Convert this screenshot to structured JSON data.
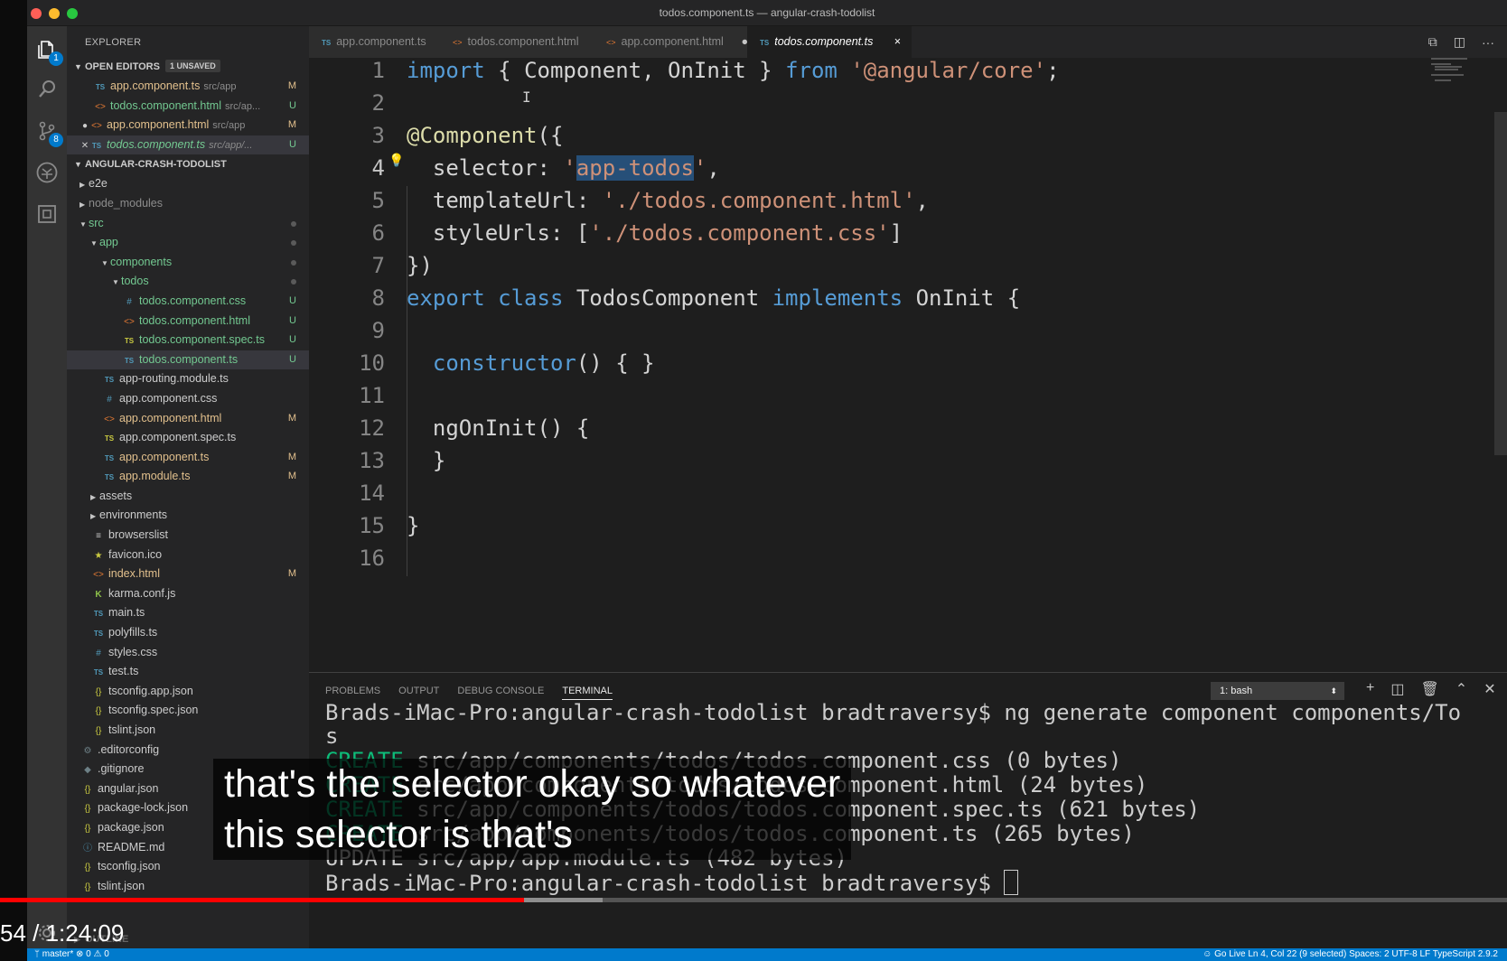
{
  "window": {
    "title": "todos.component.ts — angular-crash-todolist"
  },
  "activity_bar": {
    "explorer_badge": "1",
    "scm_badge": "8"
  },
  "sidebar": {
    "header": "EXPLORER",
    "open_editors": {
      "label": "OPEN EDITORS",
      "unsaved": "1 UNSAVED",
      "items": [
        {
          "name": "app.component.ts",
          "path": "src/app",
          "status": "M",
          "icon": "ts"
        },
        {
          "name": "todos.component.html",
          "path": "src/ap...",
          "status": "U",
          "icon": "html"
        },
        {
          "name": "app.component.html",
          "path": "src/app",
          "status": "M",
          "icon": "html"
        },
        {
          "name": "todos.component.ts",
          "path": "src/app/...",
          "status": "U",
          "icon": "ts"
        }
      ]
    },
    "project": {
      "label": "ANGULAR-CRASH-TODOLIST",
      "tree": [
        {
          "name": "e2e"
        },
        {
          "name": "node_modules"
        },
        {
          "name": "src"
        },
        {
          "name": "app"
        },
        {
          "name": "components"
        },
        {
          "name": "todos"
        },
        {
          "name": "todos.component.css",
          "status": "U"
        },
        {
          "name": "todos.component.html",
          "status": "U"
        },
        {
          "name": "todos.component.spec.ts",
          "status": "U"
        },
        {
          "name": "todos.component.ts",
          "status": "U"
        },
        {
          "name": "app-routing.module.ts"
        },
        {
          "name": "app.component.css"
        },
        {
          "name": "app.component.html",
          "status": "M"
        },
        {
          "name": "app.component.spec.ts"
        },
        {
          "name": "app.component.ts",
          "status": "M"
        },
        {
          "name": "app.module.ts",
          "status": "M"
        },
        {
          "name": "assets"
        },
        {
          "name": "environments"
        },
        {
          "name": "browserslist"
        },
        {
          "name": "favicon.ico"
        },
        {
          "name": "index.html",
          "status": "M"
        },
        {
          "name": "karma.conf.js"
        },
        {
          "name": "main.ts"
        },
        {
          "name": "polyfills.ts"
        },
        {
          "name": "styles.css"
        },
        {
          "name": "test.ts"
        },
        {
          "name": "tsconfig.app.json"
        },
        {
          "name": "tsconfig.spec.json"
        },
        {
          "name": "tslint.json"
        },
        {
          "name": ".editorconfig"
        },
        {
          "name": ".gitignore"
        },
        {
          "name": "angular.json"
        },
        {
          "name": "package-lock.json"
        },
        {
          "name": "package.json"
        },
        {
          "name": "README.md"
        },
        {
          "name": "tsconfig.json"
        },
        {
          "name": "tslint.json"
        }
      ]
    },
    "outline_label": "OUTLINE"
  },
  "tabs": [
    {
      "label": "app.component.ts",
      "icon": "TS",
      "marker": ""
    },
    {
      "label": "todos.component.html",
      "icon": "<>",
      "marker": ""
    },
    {
      "label": "app.component.html",
      "icon": "<>",
      "marker": "●"
    },
    {
      "label": "todos.component.ts",
      "icon": "TS",
      "marker": "×"
    }
  ],
  "editor": {
    "line_numbers": [
      "1",
      "2",
      "3",
      "4",
      "5",
      "6",
      "7",
      "8",
      "9",
      "10",
      "11",
      "12",
      "13",
      "14",
      "15",
      "16"
    ],
    "code": {
      "l1_import": "import",
      "l1_open": " { ",
      "l1_names": "Component, OnInit",
      "l1_close": " } ",
      "l1_from": "from",
      "l1_sp": " ",
      "l1_module": "'@angular/core'",
      "l1_semi": ";",
      "l3_deco": "@Component",
      "l3_rest": "({",
      "l4_key": "  selector: ",
      "l4_q1": "'",
      "l4_sel": "app-todos",
      "l4_q2": "'",
      "l4_comma": ",",
      "l5_key": "  templateUrl: ",
      "l5_val": "'./todos.component.html'",
      "l5_comma": ",",
      "l6_key": "  styleUrls: [",
      "l6_val": "'./todos.component.css'",
      "l6_close": "]",
      "l7": "})",
      "l8_export": "export",
      "l8_sp1": " ",
      "l8_class": "class",
      "l8_sp2": " ",
      "l8_name": "TodosComponent",
      "l8_sp3": " ",
      "l8_impl": "implements",
      "l8_sp4": " ",
      "l8_iface": "OnInit",
      "l8_brace": " {",
      "l10_fn": "  constructor",
      "l10_rest": "() { }",
      "l12_fn": "  ngOnInit",
      "l12_rest": "() {",
      "l13": "  }",
      "l15": "}"
    }
  },
  "panel": {
    "tabs": [
      "PROBLEMS",
      "OUTPUT",
      "DEBUG CONSOLE",
      "TERMINAL"
    ],
    "shell_select": "1: bash",
    "terminal": {
      "line1": "Brads-iMac-Pro:angular-crash-todolist bradtraversy$ ng generate component components/To",
      "line1b": "s",
      "create": "CREATE",
      "line2": " src/app/components/todos/todos.component.css (0 bytes)",
      "line3": " src/app/components/todos/todos.component.html (24 bytes)",
      "line4": " src/app/components/todos/todos.component.spec.ts (621 bytes)",
      "line5": " src/app/components/todos/todos.component.ts (265 bytes)",
      "update": "UPDATE src/app/app.module.ts (482 bytes)",
      "prompt": "Brads-iMac-Pro:angular-crash-todolist bradtraversy$ "
    }
  },
  "statusbar": {
    "left": "ᛘ master*  ⊗ 0 ⚠ 0",
    "right": "☺ Go Live    Ln 4, Col 22 (9 selected)    Spaces: 2    UTF-8    LF    TypeScript    2.9.2"
  },
  "video": {
    "caption_line1": "that's the selector okay so whatever",
    "caption_line2": "this selector is that's",
    "timecode": "54 / 1:24:09",
    "progress_played": 0.348,
    "progress_buffered": 0.4
  },
  "colors": {
    "accent": "#007acc",
    "progress": "#ff0000",
    "untracked": "#73c991",
    "modified": "#e2c08d"
  }
}
